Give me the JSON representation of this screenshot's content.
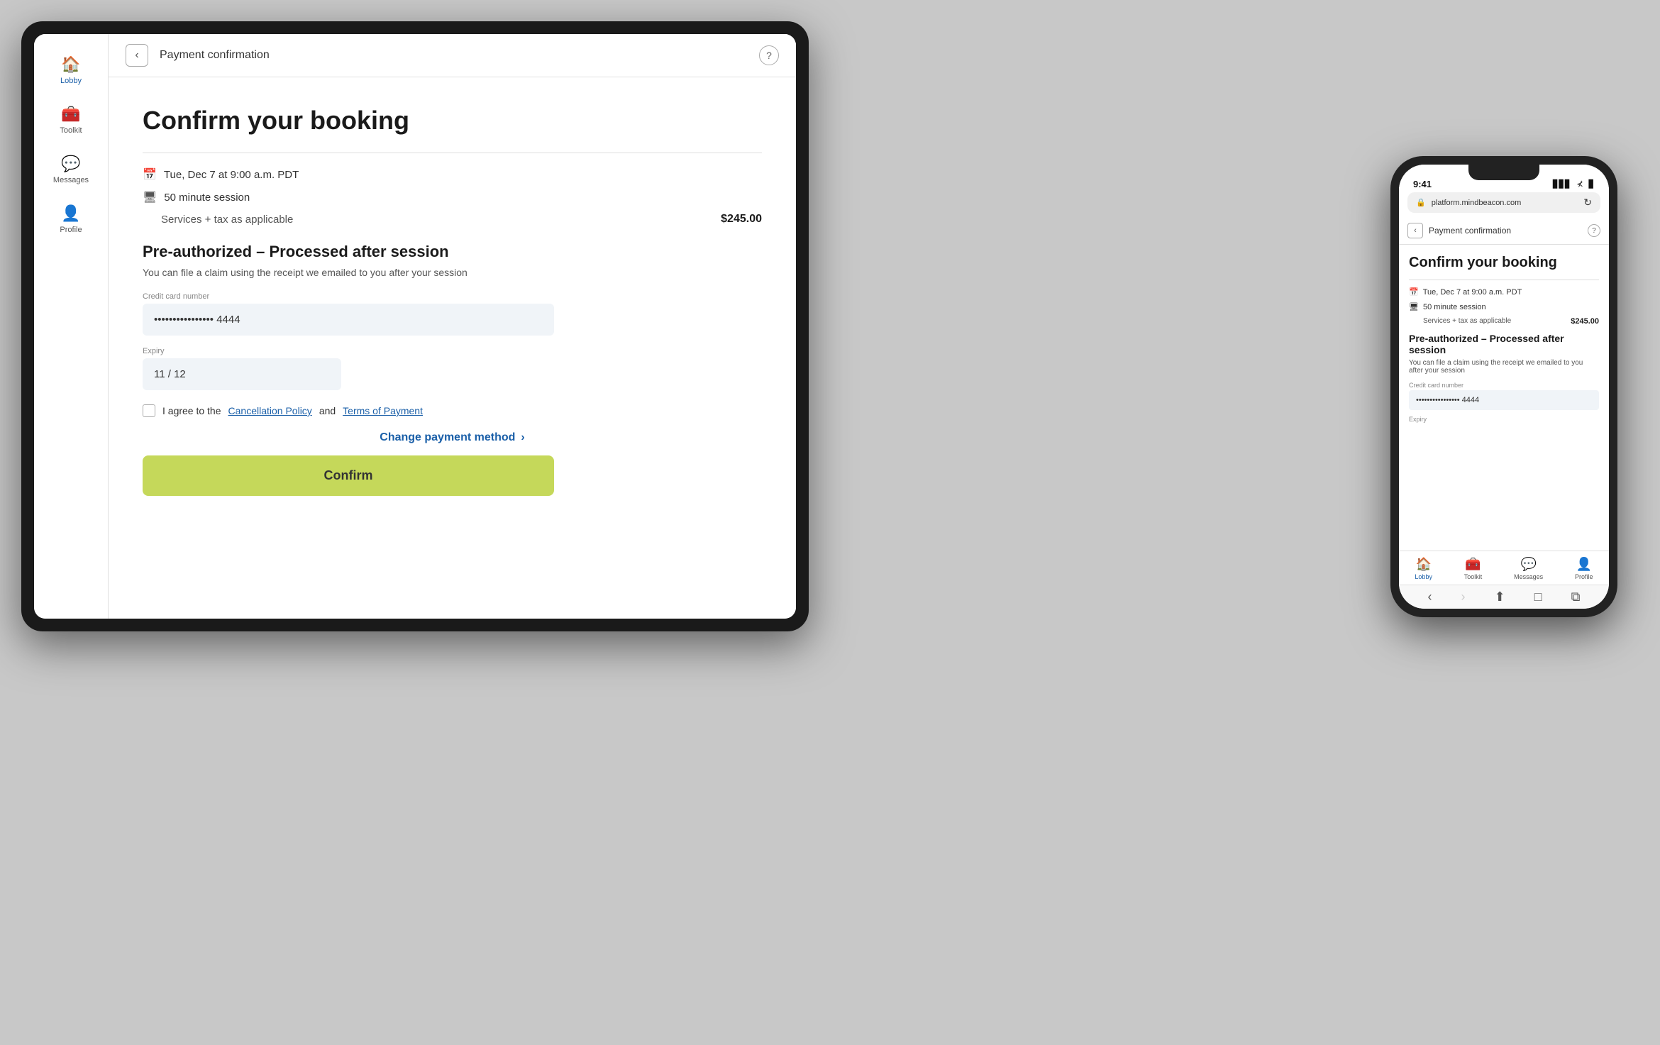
{
  "tablet": {
    "sidebar": {
      "items": [
        {
          "id": "lobby",
          "label": "Lobby",
          "icon": "🏠",
          "active": true
        },
        {
          "id": "toolkit",
          "label": "Toolkit",
          "icon": "🧰",
          "active": false
        },
        {
          "id": "messages",
          "label": "Messages",
          "icon": "💬",
          "active": false
        },
        {
          "id": "profile",
          "label": "Profile",
          "icon": "👤",
          "active": false
        }
      ]
    },
    "header": {
      "back_label": "‹",
      "title": "Payment confirmation",
      "help_label": "?"
    },
    "page": {
      "title": "Confirm your booking",
      "booking": {
        "date": "Tue, Dec 7 at 9:00 a.m. PDT",
        "session": "50 minute session",
        "services_label": "Services + tax as applicable",
        "price": "$245.00"
      },
      "preauth": {
        "title": "Pre-authorized – Processed after session",
        "subtitle": "You can file a claim using the receipt we emailed to you after your session",
        "credit_card_label": "Credit card number",
        "credit_card_value": "•••••••••••••••• 4444",
        "expiry_label": "Expiry",
        "expiry_value": "11 / 12"
      },
      "agreement": {
        "text_before": "I agree to the ",
        "cancellation_policy": "Cancellation Policy",
        "text_and": " and ",
        "terms": "Terms of Payment"
      },
      "change_payment": "Change payment method",
      "confirm_btn": "Confirm"
    }
  },
  "phone": {
    "status_bar": {
      "time": "9:41",
      "icons": "▊▊▊ ⊀ ▊"
    },
    "url_bar": {
      "url": "platform.mindbeacon.com",
      "refresh": "↻"
    },
    "header": {
      "back_label": "‹",
      "title": "Payment confirmation",
      "help_label": "?"
    },
    "page": {
      "title": "Confirm your booking",
      "booking": {
        "date": "Tue, Dec 7 at 9:00 a.m. PDT",
        "session": "50 minute session",
        "services_label": "Services + tax as applicable",
        "price": "$245.00"
      },
      "preauth": {
        "title": "Pre-authorized – Processed after session",
        "subtitle": "You can file a claim using the receipt we emailed to you after your session",
        "credit_card_label": "Credit card number",
        "credit_card_value": "•••••••••••••••• 4444",
        "expiry_label": "Expiry"
      }
    },
    "nav": {
      "items": [
        {
          "id": "lobby",
          "label": "Lobby",
          "icon": "🏠",
          "active": true
        },
        {
          "id": "toolkit",
          "label": "Toolkit",
          "icon": "🧰",
          "active": false
        },
        {
          "id": "messages",
          "label": "Messages",
          "icon": "💬",
          "active": false
        },
        {
          "id": "profile",
          "label": "Profile",
          "icon": "👤",
          "active": false
        }
      ]
    },
    "browser": {
      "back": "‹",
      "share": "⬆",
      "bookmark": "□",
      "tabs": "⧉"
    }
  }
}
